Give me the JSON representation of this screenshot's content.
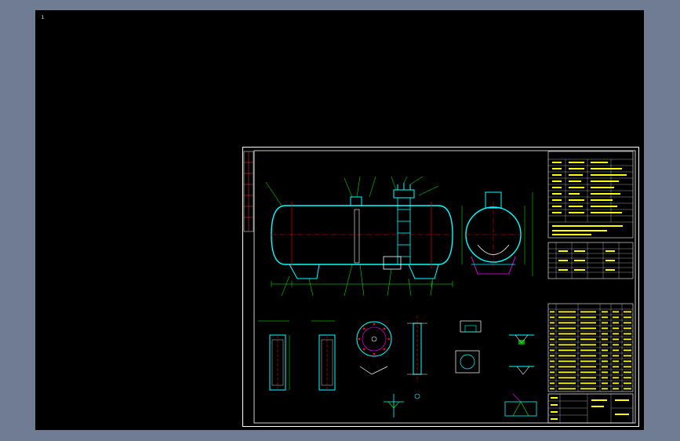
{
  "viewport": {
    "cursor_text": "ı"
  },
  "drawing": {
    "name": "horizontal-pressure-vessel-assembly",
    "colors": {
      "background": "#000000",
      "border": "#ffffff",
      "outline": "#00ffff",
      "dims": "#00ff00",
      "annotation": "#ffff00",
      "hatch": "#ff0000",
      "detail": "#ff00ff"
    }
  }
}
